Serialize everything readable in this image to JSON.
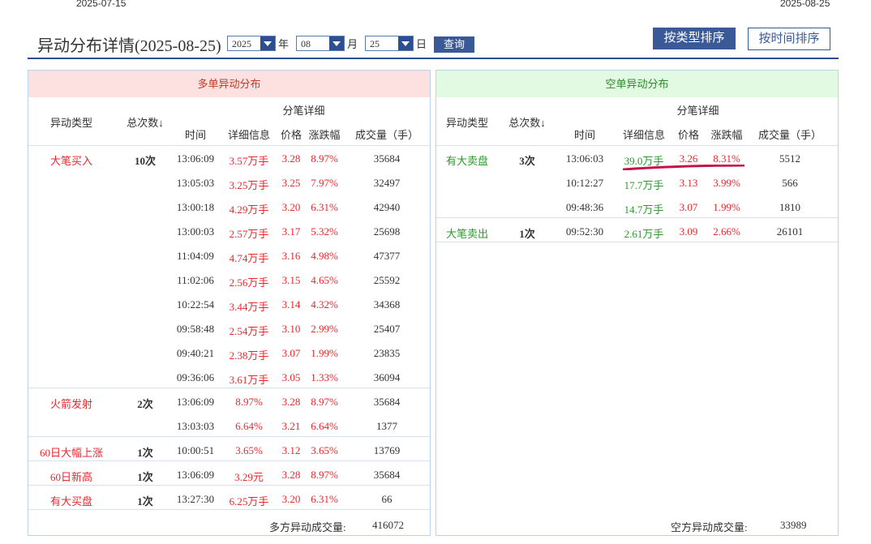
{
  "top_dates": {
    "left": "2025-07-15",
    "right": "2025-08-25"
  },
  "title": "异动分布详情(2025-08-25)",
  "query": {
    "year": "2025",
    "year_unit": "年",
    "month": "08",
    "month_unit": "月",
    "day": "25",
    "day_unit": "日",
    "button": "查询"
  },
  "sort_buttons": {
    "by_type": "按类型排序",
    "by_time": "按时间排序"
  },
  "columns": {
    "type": "异动类型",
    "count": "总次数↓",
    "detail_group": "分笔详细",
    "time": "时间",
    "info": "详细信息",
    "price": "价格",
    "change": "涨跌幅",
    "volume": "成交量（手）"
  },
  "long_panel": {
    "title": "多单异动分布",
    "groups": [
      {
        "type": "大笔买入",
        "count": "10次",
        "rows": [
          {
            "time": "13:06:09",
            "info": "3.57万手",
            "price": "3.28",
            "change": "8.97%",
            "volume": "35684"
          },
          {
            "time": "13:05:03",
            "info": "3.25万手",
            "price": "3.25",
            "change": "7.97%",
            "volume": "32497"
          },
          {
            "time": "13:00:18",
            "info": "4.29万手",
            "price": "3.20",
            "change": "6.31%",
            "volume": "42940"
          },
          {
            "time": "13:00:03",
            "info": "2.57万手",
            "price": "3.17",
            "change": "5.32%",
            "volume": "25698"
          },
          {
            "time": "11:04:09",
            "info": "4.74万手",
            "price": "3.16",
            "change": "4.98%",
            "volume": "47377"
          },
          {
            "time": "11:02:06",
            "info": "2.56万手",
            "price": "3.15",
            "change": "4.65%",
            "volume": "25592"
          },
          {
            "time": "10:22:54",
            "info": "3.44万手",
            "price": "3.14",
            "change": "4.32%",
            "volume": "34368"
          },
          {
            "time": "09:58:48",
            "info": "2.54万手",
            "price": "3.10",
            "change": "2.99%",
            "volume": "25407"
          },
          {
            "time": "09:40:21",
            "info": "2.38万手",
            "price": "3.07",
            "change": "1.99%",
            "volume": "23835"
          },
          {
            "time": "09:36:06",
            "info": "3.61万手",
            "price": "3.05",
            "change": "1.33%",
            "volume": "36094"
          }
        ]
      },
      {
        "type": "火箭发射",
        "count": "2次",
        "rows": [
          {
            "time": "13:06:09",
            "info": "8.97%",
            "price": "3.28",
            "change": "8.97%",
            "volume": "35684"
          },
          {
            "time": "13:03:03",
            "info": "6.64%",
            "price": "3.21",
            "change": "6.64%",
            "volume": "1377"
          }
        ]
      },
      {
        "type": "60日大幅上涨",
        "count": "1次",
        "rows": [
          {
            "time": "10:00:51",
            "info": "3.65%",
            "price": "3.12",
            "change": "3.65%",
            "volume": "13769"
          }
        ]
      },
      {
        "type": "60日新高",
        "count": "1次",
        "rows": [
          {
            "time": "13:06:09",
            "info": "3.29元",
            "price": "3.28",
            "change": "8.97%",
            "volume": "35684"
          }
        ]
      },
      {
        "type": "有大买盘",
        "count": "1次",
        "rows": [
          {
            "time": "13:27:30",
            "info": "6.25万手",
            "price": "3.20",
            "change": "6.31%",
            "volume": "66"
          }
        ]
      }
    ],
    "total_label": "多方异动成交量:",
    "total_value": "416072"
  },
  "short_panel": {
    "title": "空单异动分布",
    "groups": [
      {
        "type": "有大卖盘",
        "count": "3次",
        "rows": [
          {
            "time": "13:06:03",
            "info": "39.0万手",
            "price": "3.26",
            "change": "8.31%",
            "volume": "5512"
          },
          {
            "time": "10:12:27",
            "info": "17.7万手",
            "price": "3.13",
            "change": "3.99%",
            "volume": "566"
          },
          {
            "time": "09:48:36",
            "info": "14.7万手",
            "price": "3.07",
            "change": "1.99%",
            "volume": "1810"
          }
        ]
      },
      {
        "type": "大笔卖出",
        "count": "1次",
        "rows": [
          {
            "time": "09:52:30",
            "info": "2.61万手",
            "price": "3.09",
            "change": "2.66%",
            "volume": "26101"
          }
        ]
      }
    ],
    "total_label": "空方异动成交量:",
    "total_value": "33989"
  },
  "colors": {
    "accent": "#3a5a97",
    "up": "#e8282e",
    "down": "#2a9a2a",
    "underline": "#c8104a"
  }
}
